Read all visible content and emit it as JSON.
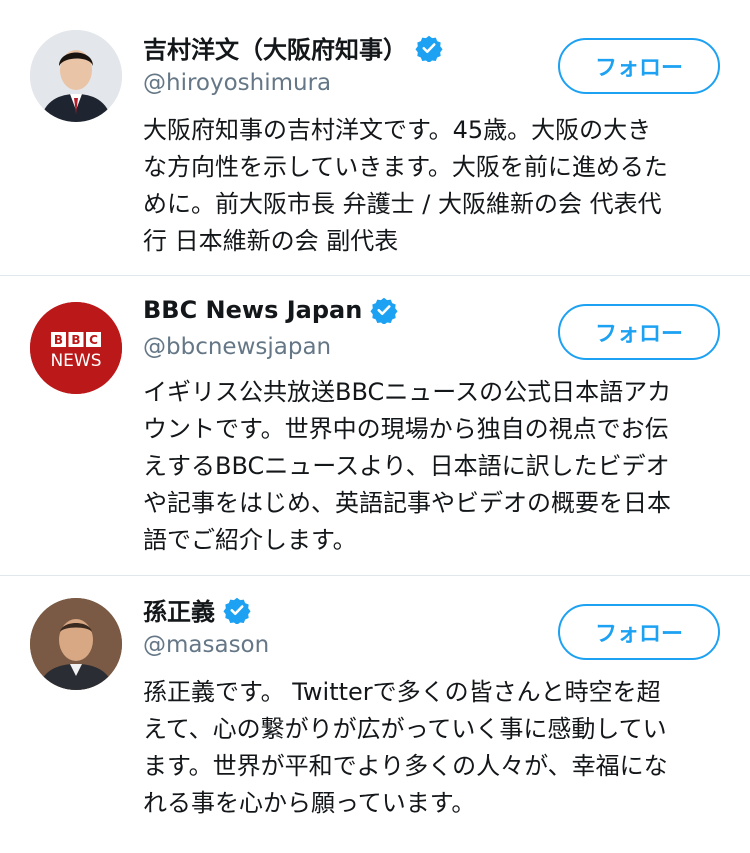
{
  "accounts": [
    {
      "name": "吉村洋文（大阪府知事）",
      "handle": "@hiroyoshimura",
      "follow_label": "フォロー",
      "bio_lines": [
        "大阪府知事の吉村洋文です。45歳。大阪の大き",
        "な方向性を示していきます。大阪を前に進めるた",
        "めに。前大阪市長 弁護士 / 大阪維新の会 代表代",
        "行 日本維新の会 副代表"
      ],
      "avatar": "person-suit-photo"
    },
    {
      "name": "BBC News Japan",
      "handle": "@bbcnewsjapan",
      "follow_label": "フォロー",
      "bio_lines": [
        "イギリス公共放送BBCニュースの公式日本語アカ",
        "ウントです。世界中の現場から独自の視点でお伝",
        "えするBBCニュースより、日本語に訳したビデオ",
        "や記事をはじめ、英語記事やビデオの概要を日本",
        "語でご紹介します。"
      ],
      "avatar": "bbc-news-logo",
      "logo_text": {
        "top": "BBC",
        "bottom": "NEWS"
      }
    },
    {
      "name": "孫正義",
      "handle": "@masason",
      "follow_label": "フォロー",
      "bio_lines": [
        "孫正義です。 Twitterで多くの皆さんと時空を超",
        "えて、心の繋がりが広がっていく事に感動してい",
        "ます。世界が平和でより多くの人々が、幸福にな",
        "れる事を心から願っています。"
      ],
      "avatar": "person-photo"
    }
  ],
  "colors": {
    "accent": "#1da1f2",
    "text": "#14171a",
    "secondary": "#657786",
    "divider": "#e1e8ed",
    "bbc_red": "#bb1919"
  },
  "icons": {
    "verified": "verified-badge-icon"
  }
}
